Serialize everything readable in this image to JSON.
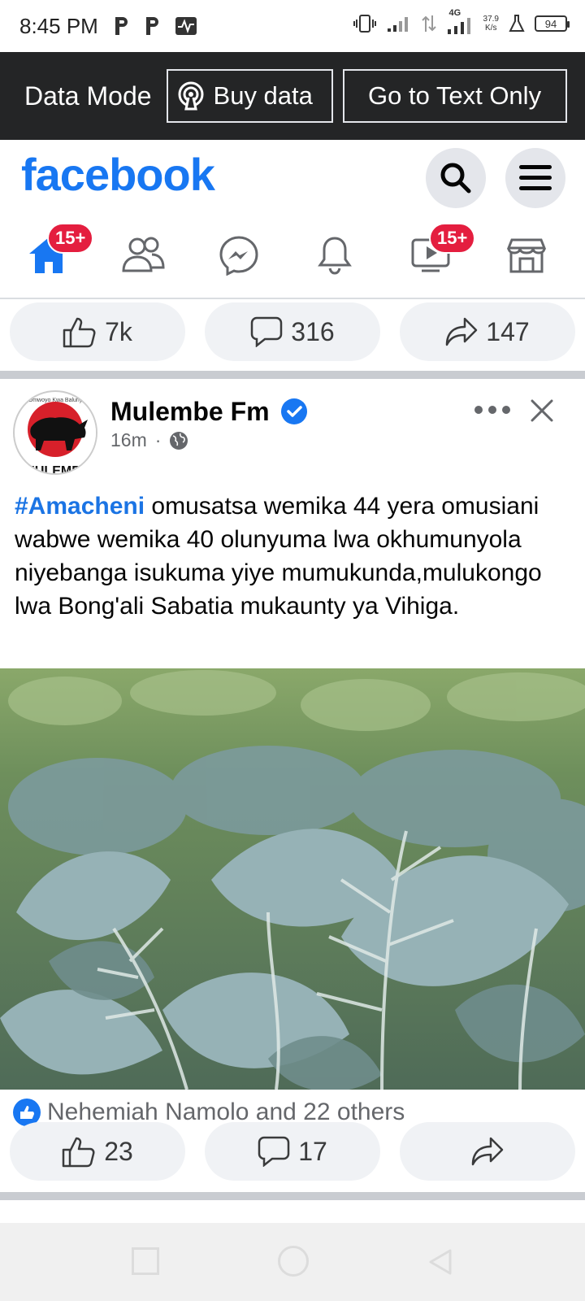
{
  "status_bar": {
    "time": "8:45 PM",
    "net_speed": "37.9",
    "net_unit": "K/s",
    "network_type": "4G",
    "battery": "94",
    "left_icons": [
      "p-icon",
      "p-icon",
      "activity-icon"
    ]
  },
  "data_bar": {
    "mode_label": "Data Mode",
    "buy_label": "Buy data",
    "text_only_label": "Go to Text Only"
  },
  "header": {
    "logo_text": "facebook",
    "brand_color": "#1877f2"
  },
  "nav": {
    "tabs": [
      {
        "name": "home",
        "icon": "home-icon",
        "badge": "15+"
      },
      {
        "name": "friends",
        "icon": "friends-icon",
        "badge": ""
      },
      {
        "name": "messenger",
        "icon": "messenger-icon",
        "badge": ""
      },
      {
        "name": "notifications",
        "icon": "bell-icon",
        "badge": ""
      },
      {
        "name": "watch",
        "icon": "video-icon",
        "badge": "15+"
      },
      {
        "name": "marketplace",
        "icon": "store-icon",
        "badge": ""
      }
    ]
  },
  "prev_post": {
    "likes": "7k",
    "comments": "316",
    "shares": "147"
  },
  "post": {
    "page_name": "Mulembe Fm",
    "avatar_label_top": "Omwoyo Kwa Baluhya",
    "avatar_label_bottom": "MULEMBE",
    "time": "16m",
    "separator": "·",
    "hashtag": "#Amacheni",
    "body": " omusatsa wemika 44 yera omusiani wabwe wemika 40 olunyuma lwa okhumunyola niyebanga isukuma yiye mumukunda,mulukongo lwa Bong'ali  Sabatia mukaunty ya Vihiga.",
    "reactions_text": "Nehemiah Namolo and 22 others",
    "likes": "23",
    "comments": "17",
    "shares": ""
  }
}
